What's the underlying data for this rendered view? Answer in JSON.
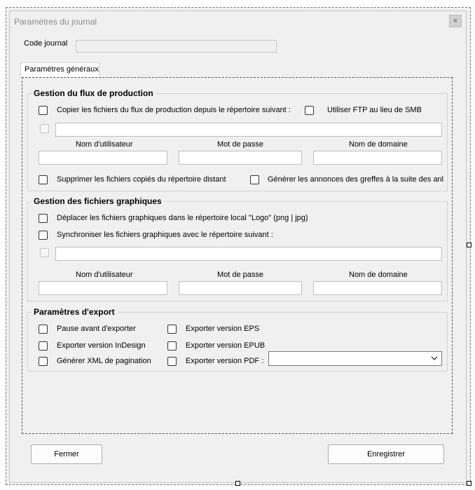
{
  "window": {
    "title": "Paramètres du journal",
    "close_glyph": "×"
  },
  "code_journal": {
    "label": "Code journal",
    "value": ""
  },
  "tabs": [
    {
      "label": "Paramètres généraux"
    }
  ],
  "flux": {
    "title": "Gestion du flux de production",
    "copy_label": "Copier les fichiers du flux de production depuis le répertoire suivant :",
    "ftp_label": "Utiliser FTP au lieu de SMB",
    "path_value": "",
    "user_label": "Nom d'utilisateur",
    "password_label": "Mot de passe",
    "domain_label": "Nom de domaine",
    "delete_label": "Supprimer les fichiers copiés du répertoire distant",
    "announce_label": "Générer les annonces des greffes à la suite des anl"
  },
  "graphics": {
    "title": "Gestion des fichiers graphiques",
    "move_label": "Déplacer les fichiers graphiques dans le répertoire local \"Logo\" (png | jpg)",
    "sync_label": "Synchroniser les fichiers graphiques avec le répertoire suivant :",
    "path_value": "",
    "user_label": "Nom d'utilisateur",
    "password_label": "Mot de passe",
    "domain_label": "Nom de domaine"
  },
  "export": {
    "title": "Paramètres d'export",
    "pause_label": "Pause avant d'exporter",
    "indesign_label": "Exporter version InDesign",
    "xml_label": "Générer XML de pagination",
    "eps_label": "Exporter version EPS",
    "epub_label": "Exporter version EPUB",
    "pdf_label": "Exporter version PDF :",
    "pdf_selected": ""
  },
  "buttons": {
    "close": "Fermer",
    "save": "Enregistrer"
  },
  "icons": {
    "close": "close-icon",
    "dropdown": "chevron-down-icon"
  }
}
